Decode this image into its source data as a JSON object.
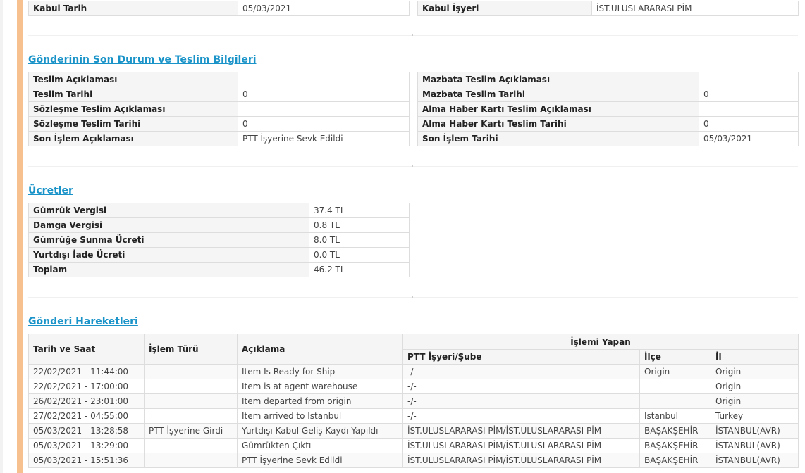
{
  "kabul": {
    "left": {
      "label": "Kabul Tarih",
      "value": "05/03/2021"
    },
    "right": {
      "label": "Kabul İşyeri",
      "value": "İST.ULUSLARARASI PİM"
    }
  },
  "son_durum": {
    "title": "Gönderinin Son Durum ve Teslim Bilgileri",
    "left": [
      {
        "label": "Teslim Açıklaması",
        "value": ""
      },
      {
        "label": "Teslim Tarihi",
        "value": "0"
      },
      {
        "label": "Sözleşme Teslim Açıklaması",
        "value": ""
      },
      {
        "label": "Sözleşme Teslim Tarihi",
        "value": "0"
      },
      {
        "label": "Son İşlem Açıklaması",
        "value": "PTT İşyerine Sevk Edildi"
      }
    ],
    "right": [
      {
        "label": "Mazbata Teslim Açıklaması",
        "value": ""
      },
      {
        "label": "Mazbata Teslim Tarihi",
        "value": "0"
      },
      {
        "label": "Alma Haber Kartı Teslim Açıklaması",
        "value": ""
      },
      {
        "label": "Alma Haber Kartı Teslim Tarihi",
        "value": "0"
      },
      {
        "label": "Son İşlem Tarihi",
        "value": "05/03/2021"
      }
    ]
  },
  "ucretler": {
    "title": "Ücretler",
    "rows": [
      {
        "label": "Gümrük Vergisi",
        "value": "37.4 TL"
      },
      {
        "label": "Damga Vergisi",
        "value": "0.8 TL"
      },
      {
        "label": "Gümrüğe Sunma Ücreti",
        "value": "8.0 TL"
      },
      {
        "label": "Yurtdışı İade Ücreti",
        "value": "0.0 TL"
      },
      {
        "label": "Toplam",
        "value": "46.2 TL"
      }
    ]
  },
  "hareketler": {
    "title": "Gönderi Hareketleri",
    "headers": {
      "tarih": "Tarih ve Saat",
      "islem": "İşlem Türü",
      "aciklama": "Açıklama",
      "yapan": "İşlemi Yapan",
      "sube": "PTT İşyeri/Şube",
      "ilce": "İlçe",
      "il": "İl"
    },
    "rows": [
      {
        "tarih": "22/02/2021 - 11:44:00",
        "islem": "",
        "aciklama": "Item Is Ready for Ship",
        "sube": "-/-",
        "ilce": "Origin",
        "il": "Origin"
      },
      {
        "tarih": "22/02/2021 - 17:00:00",
        "islem": "",
        "aciklama": "Item is at agent warehouse",
        "sube": "-/-",
        "ilce": "",
        "il": "Origin"
      },
      {
        "tarih": "26/02/2021 - 23:01:00",
        "islem": "",
        "aciklama": "Item departed from origin",
        "sube": "-/-",
        "ilce": "",
        "il": "Origin"
      },
      {
        "tarih": "27/02/2021 - 04:55:00",
        "islem": "",
        "aciklama": "Item arrived to Istanbul",
        "sube": "-/-",
        "ilce": "Istanbul",
        "il": "Turkey"
      },
      {
        "tarih": "05/03/2021 - 13:28:58",
        "islem": "PTT İşyerine Girdi",
        "aciklama": "Yurtdışı Kabul Geliş Kaydı Yapıldı",
        "sube": "İST.ULUSLARARASI PİM/İST.ULUSLARARASI PİM",
        "ilce": "BAŞAKŞEHİR",
        "il": "İSTANBUL(AVR)"
      },
      {
        "tarih": "05/03/2021 - 13:29:00",
        "islem": "",
        "aciklama": "Gümrükten Çıktı",
        "sube": "İST.ULUSLARARASI PİM/İST.ULUSLARARASI PİM",
        "ilce": "BAŞAKŞEHİR",
        "il": "İSTANBUL(AVR)"
      },
      {
        "tarih": "05/03/2021 - 15:51:36",
        "islem": "",
        "aciklama": "PTT İşyerine Sevk Edildi",
        "sube": "İST.ULUSLARARASI PİM/İST.ULUSLARARASI PİM",
        "ilce": "BAŞAKŞEHİR",
        "il": "İSTANBUL(AVR)"
      }
    ]
  }
}
